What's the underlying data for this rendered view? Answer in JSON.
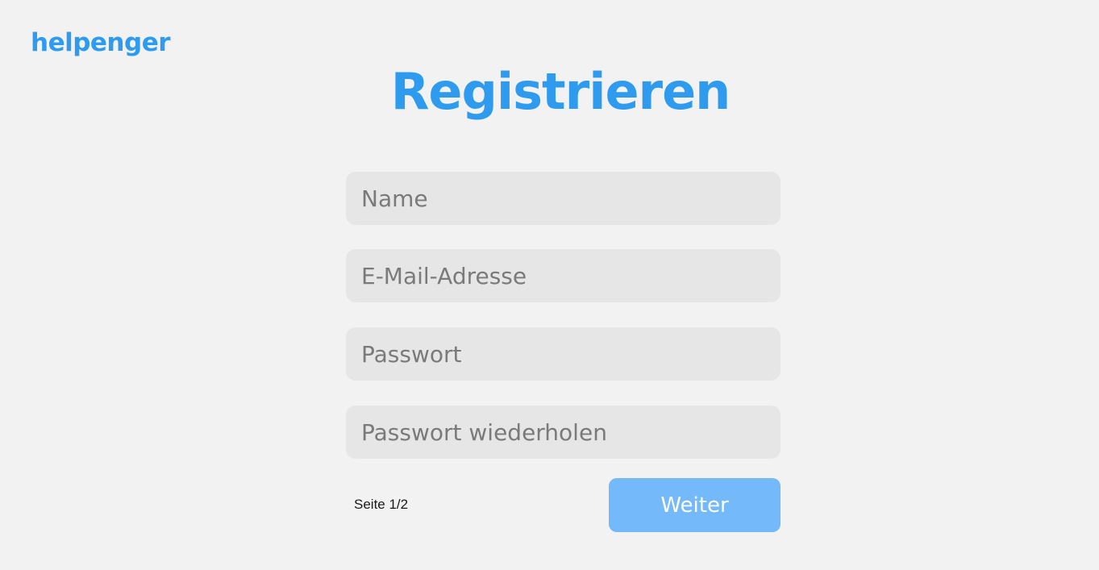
{
  "brand": {
    "logo_text": "helpenger"
  },
  "page": {
    "title": "Registrieren",
    "page_indicator": "Seite 1/2"
  },
  "form": {
    "fields": [
      {
        "placeholder": "Name",
        "value": ""
      },
      {
        "placeholder": "E-Mail-Adresse",
        "value": ""
      },
      {
        "placeholder": "Passwort",
        "value": ""
      },
      {
        "placeholder": "Passwort wiederholen",
        "value": ""
      }
    ],
    "next_button_label": "Weiter"
  },
  "colors": {
    "background": "#f2f2f2",
    "brand_blue": "#2e9bef",
    "field_background": "#e6e6e6",
    "button_background": "#74b9f9",
    "placeholder_text": "#7a7a7a"
  }
}
